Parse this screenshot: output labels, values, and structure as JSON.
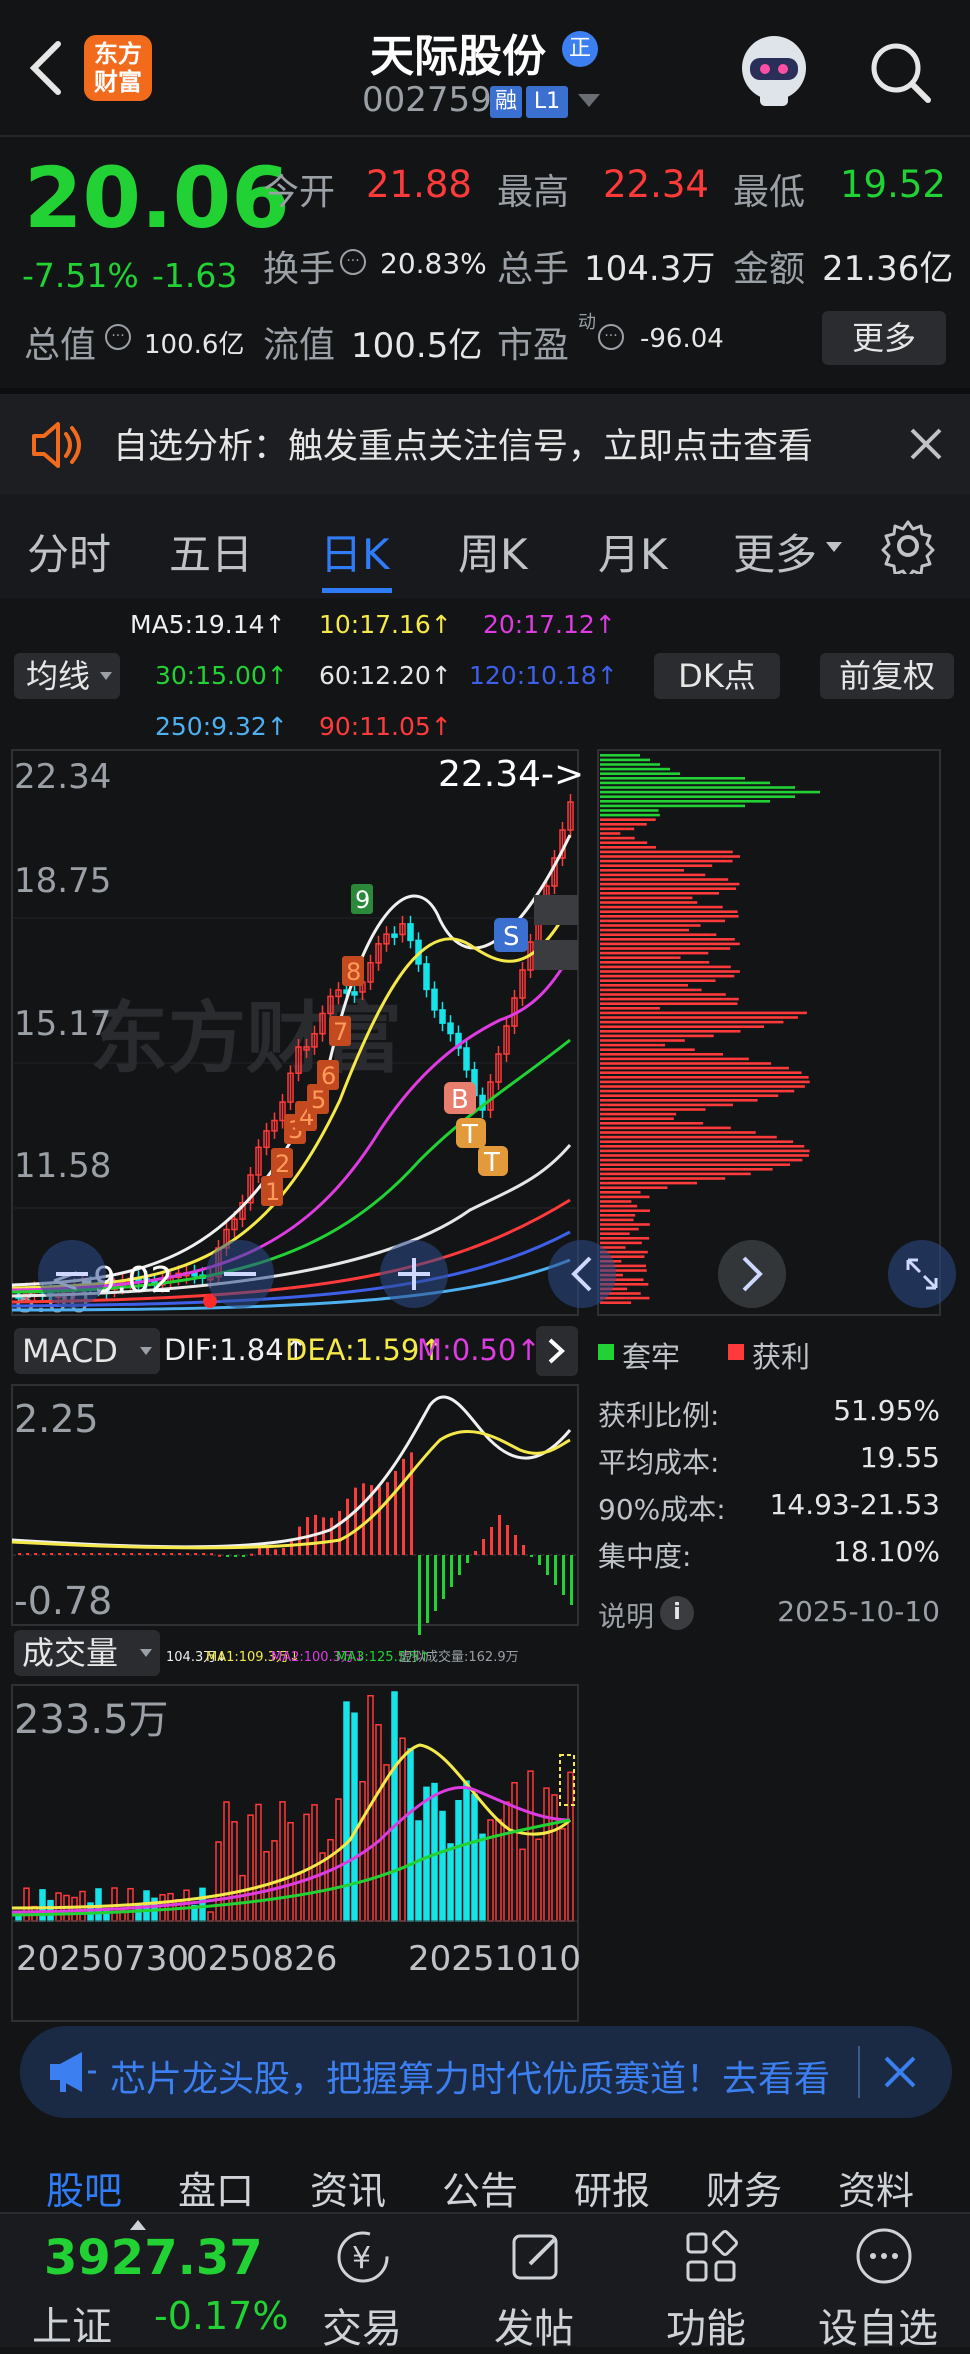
{
  "header": {
    "title": "天际股份",
    "title_badge": "正",
    "code": "002759",
    "margin_tag": "融",
    "level_tag": "L1",
    "logo_line1": "东方",
    "logo_line2": "财富"
  },
  "quote": {
    "price": "20.06",
    "change_pct": "-7.51%",
    "change": "-1.63",
    "open_label": "今开",
    "open": "21.88",
    "high_label": "最高",
    "high": "22.34",
    "low_label": "最低",
    "low": "19.52",
    "turnover_label": "换手",
    "turnover": "20.83%",
    "volume_label": "总手",
    "volume": "104.3万",
    "amount_label": "金额",
    "amount": "21.36亿",
    "mktcap_label": "总值",
    "mktcap": "100.6亿",
    "float_label": "流值",
    "float_cap": "100.5亿",
    "pe_label": "市盈",
    "pe_sup": "动",
    "pe": "-96.04",
    "more_button": "更多"
  },
  "notice": {
    "text": "自选分析：触发重点关注信号，立即点击查看"
  },
  "tabs": {
    "items": [
      "分时",
      "五日",
      "日K",
      "周K",
      "月K",
      "更多"
    ],
    "active": 2
  },
  "ma": {
    "ma5": "MA5:19.14↑",
    "ma10": "10:17.16↑",
    "ma20": "20:17.12↑",
    "ma30": "30:15.00↑",
    "ma60": "60:12.20↑",
    "ma120": "120:10.18↑",
    "ma250": "250:9.32↑",
    "ma90": "90:11.05↑",
    "selector": "均线",
    "dk_button": "DK点",
    "adjust_button": "前复权"
  },
  "kline": {
    "y_labels": [
      "22.34",
      "18.75",
      "15.17",
      "11.58",
      "8.00"
    ],
    "high_mark": "22.34->",
    "low_mark": "<-9.02",
    "signal_s": "S",
    "signal_b": "B",
    "signal_t": "T",
    "seq": [
      "1",
      "2",
      "3",
      "4",
      "5",
      "6",
      "7",
      "8",
      "9"
    ],
    "watermark": "东方财富"
  },
  "macd": {
    "selector": "MACD",
    "dif": "DIF:1.84↑",
    "dea": "DEA:1.59↑",
    "m": "M:0.50↑",
    "y_top": "2.25",
    "y_bottom": "-0.78"
  },
  "volume": {
    "selector": "成交量",
    "line1": "104.3万↓",
    "line2": "MA1:109.3万↓",
    "line3": "MA2:100.3万↓",
    "line4": "MA3:125.5万↑",
    "line5": "虚拟成交量:162.9万",
    "y_top": "233.5万",
    "dates": [
      "20250730",
      "0250826",
      "20251010"
    ]
  },
  "chips": {
    "legend_trap": "套牢",
    "legend_profit": "获利",
    "rows": [
      {
        "label": "获利比例:",
        "value": "51.95%"
      },
      {
        "label": "平均成本:",
        "value": "19.55"
      },
      {
        "label": "90%成本:",
        "value": "14.93-21.53"
      },
      {
        "label": "集中度:",
        "value": "18.10%"
      }
    ],
    "note_label": "说明",
    "date": "2025-10-10"
  },
  "ad": {
    "text": "芯片龙头股，把握算力时代优质赛道！去看看"
  },
  "subnav": {
    "items": [
      "股吧",
      "盘口",
      "资讯",
      "公告",
      "研报",
      "财务",
      "资料"
    ],
    "active": 0
  },
  "footer": {
    "index_value": "3927.37",
    "index_name": "上证",
    "index_change": "-0.17%",
    "trade": "交易",
    "post": "发帖",
    "func": "功能",
    "watch": "设自选"
  },
  "colors": {
    "up": "#ff3a3a",
    "down": "#22d134",
    "accent": "#2f7cf6",
    "cyan": "#17e3e8"
  }
}
